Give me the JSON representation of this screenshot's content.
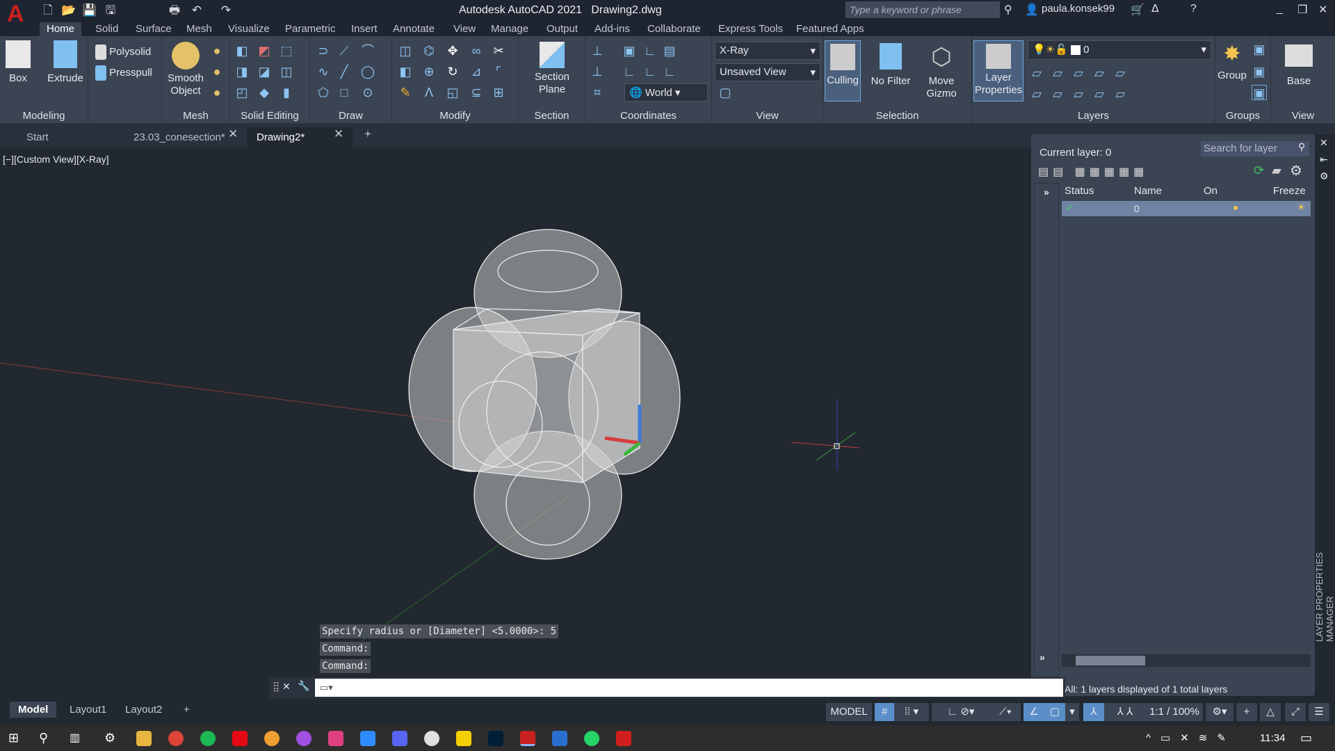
{
  "title_bar": {
    "app_title": "Autodesk AutoCAD 2021",
    "file_name": "Drawing2.dwg",
    "search_placeholder": "Type a keyword or phrase",
    "user": "paula.konsek99"
  },
  "menu_tabs": [
    "Home",
    "Solid",
    "Surface",
    "Mesh",
    "Visualize",
    "Parametric",
    "Insert",
    "Annotate",
    "View",
    "Manage",
    "Output",
    "Add-ins",
    "Collaborate",
    "Express Tools",
    "Featured Apps"
  ],
  "ribbon": {
    "modeling": {
      "label": "Modeling",
      "box": "Box",
      "extrude": "Extrude",
      "polysolid": "Polysolid",
      "presspull": "Presspull"
    },
    "mesh": {
      "label": "Mesh",
      "smooth_object": "Smooth Object"
    },
    "solid_editing": {
      "label": "Solid Editing"
    },
    "draw": {
      "label": "Draw"
    },
    "modify": {
      "label": "Modify"
    },
    "section": {
      "label": "Section",
      "section_plane": "Section Plane"
    },
    "coordinates": {
      "label": "Coordinates",
      "ucs": "World"
    },
    "view": {
      "label": "View",
      "visual_style": "X-Ray",
      "named_view": "Unsaved View"
    },
    "selection": {
      "label": "Selection",
      "culling": "Culling",
      "no_filter": "No Filter",
      "move_gizmo": "Move Gizmo"
    },
    "layers": {
      "label": "Layers",
      "layer_properties": "Layer Properties",
      "current_layer": "0"
    },
    "groups": {
      "label": "Groups",
      "group": "Group"
    },
    "view2": {
      "label": "View",
      "base": "Base"
    }
  },
  "file_tabs": [
    {
      "label": "Start"
    },
    {
      "label": "23.03_conesection*"
    },
    {
      "label": "Drawing2*"
    }
  ],
  "viewport": {
    "label": "[−][Custom View][X-Ray]"
  },
  "layer_manager": {
    "current_layer": "Current layer: 0",
    "search_placeholder": "Search for layer",
    "columns": [
      "Status",
      "Name",
      "On",
      "Freeze"
    ],
    "rows": [
      {
        "name": "0"
      }
    ],
    "footer": "All: 1 layers displayed of 1 total layers",
    "side_title": "LAYER PROPERTIES MANAGER"
  },
  "command": {
    "history": [
      "Specify radius or [Diameter] <5.0000>: 5",
      "Command:",
      "Command:"
    ],
    "input": ""
  },
  "layout_tabs": [
    "Model",
    "Layout1",
    "Layout2"
  ],
  "status_bar": {
    "space": "MODEL",
    "scale": "1:1 / 100%"
  },
  "taskbar": {
    "time": "11:34"
  },
  "colors": {
    "accent": "#5a8ec8",
    "ribbon_bg": "#3b4453",
    "viewport_bg": "#212830",
    "autocad_red": "#c8201e"
  }
}
